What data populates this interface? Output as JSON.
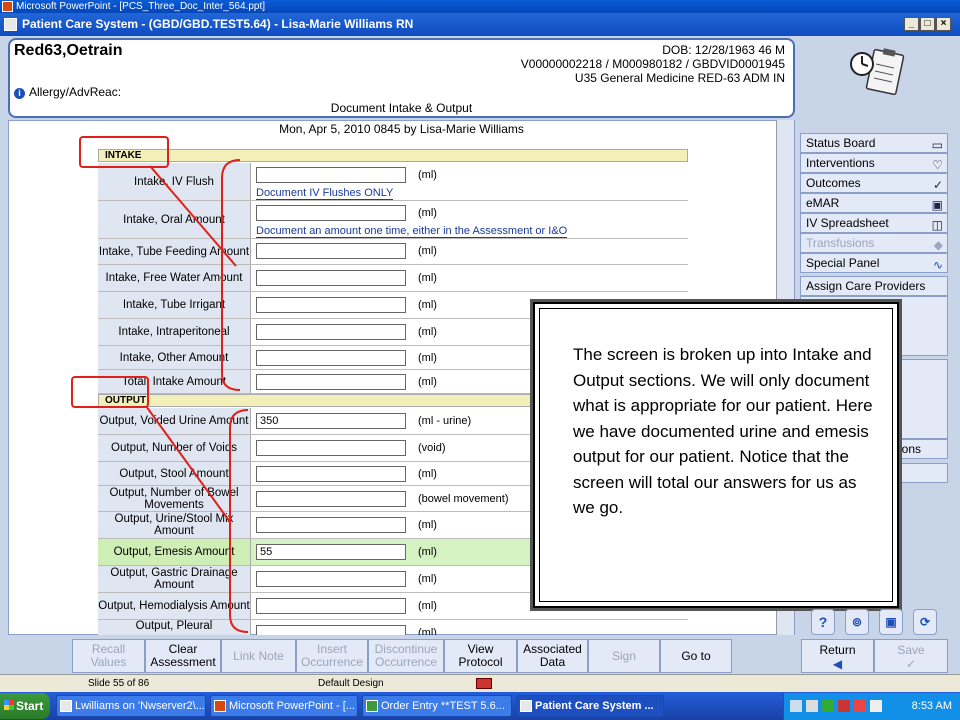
{
  "powerpoint_title": "Microsoft PowerPoint - [PCS_Three_Doc_Inter_564.ppt]",
  "app_title": "Patient Care System - (GBD/GBD.TEST5.64) - Lisa-Marie Williams RN",
  "patient": {
    "name": "Red63,Oetrain",
    "dob": "DOB: 12/28/1963 46 M",
    "ids": "V00000002218 / M000980182 / GBDVID0001945",
    "location": "U35 General Medicine  RED-63  ADM IN",
    "allergy": "Allergy/AdvReac:"
  },
  "document_title": "Document Intake & Output",
  "form_date": "Mon, Apr 5, 2010 0845  by  Lisa-Marie Williams",
  "intake_header": "INTAKE",
  "output_header": "OUTPUT",
  "intake_rows": [
    {
      "label": "Intake, IV Flush",
      "value": "",
      "unit": "(ml)",
      "note": "Document IV Flushes ONLY"
    },
    {
      "label": "Intake, Oral Amount",
      "value": "",
      "unit": "(ml)",
      "note": "Document an amount one time, either in the  Assessment or I&O"
    },
    {
      "label": "Intake, Tube Feeding Amount",
      "value": "",
      "unit": "(ml)"
    },
    {
      "label": "Intake, Free Water Amount",
      "value": "",
      "unit": "(ml)"
    },
    {
      "label": "Intake, Tube Irrigant",
      "value": "",
      "unit": "(ml)"
    },
    {
      "label": "Intake, Intraperitoneal",
      "value": "",
      "unit": "(ml)"
    },
    {
      "label": "Intake, Other Amount",
      "value": "",
      "unit": "(ml)"
    },
    {
      "label": "Total, Intake Amount",
      "value": "",
      "unit": "(ml)"
    }
  ],
  "output_rows": [
    {
      "label": "Output, Voided Urine Amount",
      "value": "350",
      "unit": "(ml - urine)"
    },
    {
      "label": "Output, Number of Voids",
      "value": "",
      "unit": "(void)"
    },
    {
      "label": "Output, Stool Amount",
      "value": "",
      "unit": "(ml)"
    },
    {
      "label": "Output, Number of Bowel Movements",
      "value": "",
      "unit": "(bowel movement)"
    },
    {
      "label": "Output, Urine/Stool Mix Amount",
      "value": "",
      "unit": "(ml)"
    },
    {
      "label": "Output, Emesis Amount",
      "value": "55",
      "unit": "(ml)"
    },
    {
      "label": "Output, Gastric Drainage Amount",
      "value": "",
      "unit": "(ml)"
    },
    {
      "label": "Output, Hemodialysis Amount",
      "value": "",
      "unit": "(ml)"
    },
    {
      "label": "Output, Pleural",
      "value": "",
      "unit": "(ml)"
    }
  ],
  "side_menu": [
    {
      "label": "Status Board",
      "icon": "folder-icon",
      "glyph": "▭",
      "disabled": false
    },
    {
      "label": "Interventions",
      "icon": "stethoscope-icon",
      "glyph": "♡",
      "disabled": false
    },
    {
      "label": "Outcomes",
      "icon": "checklist-icon",
      "glyph": "✓",
      "disabled": false
    },
    {
      "label": "eMAR",
      "icon": "medication-icon",
      "glyph": "▣",
      "disabled": false
    },
    {
      "label": "IV Spreadsheet",
      "icon": "iv-bag-icon",
      "glyph": "◫",
      "disabled": false
    },
    {
      "label": "Transfusions",
      "icon": "blood-drop-icon",
      "glyph": "◆",
      "disabled": true
    },
    {
      "label": "Special Panel",
      "icon": "pulse-icon",
      "glyph": "∿",
      "disabled": false
    },
    {
      "label": "Assign Care Providers",
      "icon": "",
      "glyph": "",
      "disabled": false
    }
  ],
  "side_partial": "ions",
  "popup_text": "The screen is broken up into Intake and Output sections. We will only document what is appropriate for our patient. Here we have documented urine and emesis output for our patient. Notice that the screen will total our answers for us as we go.",
  "toolbar": [
    {
      "label": "Recall Values",
      "disabled": true
    },
    {
      "label": "Clear Assessment",
      "disabled": false
    },
    {
      "label": "Link Note",
      "disabled": true
    },
    {
      "label": "Insert Occurrence",
      "disabled": true
    },
    {
      "label": "Discontinue Occurrence",
      "disabled": true
    },
    {
      "label": "View Protocol",
      "disabled": false
    },
    {
      "label": "Associated Data",
      "disabled": false
    },
    {
      "label": "Sign",
      "disabled": true
    },
    {
      "label": "Go to",
      "disabled": false
    }
  ],
  "right_buttons": {
    "return_label": "Return",
    "save_label": "Save"
  },
  "pp_status": {
    "slide": "Slide 55 of 86",
    "design": "Default Design"
  },
  "taskbar": {
    "start": "Start",
    "tasks": [
      "Lwilliams on 'Nwserver2\\...",
      "Microsoft PowerPoint - [...",
      "Order Entry **TEST 5.6...",
      "Patient Care System ..."
    ],
    "clock": "8:53 AM"
  }
}
